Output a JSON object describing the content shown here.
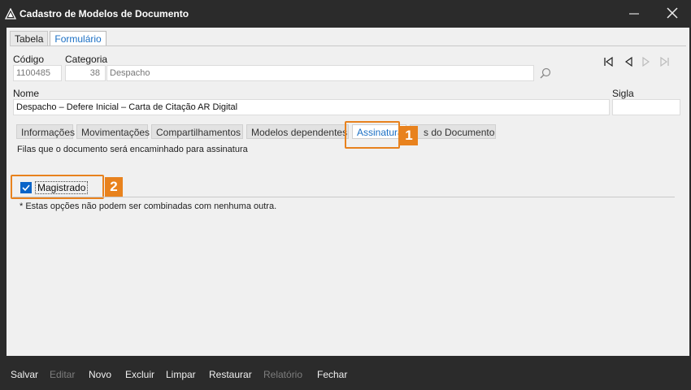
{
  "window": {
    "title": "Cadastro de Modelos de Documento"
  },
  "view_tabs": [
    {
      "label": "Tabela",
      "active": false
    },
    {
      "label": "Formulário",
      "active": true
    }
  ],
  "form": {
    "codigo_label": "Código",
    "codigo_value": "1100485",
    "categoria_label": "Categoria",
    "categoria_code": "38",
    "categoria_value": "Despacho",
    "nome_label": "Nome",
    "nome_value": "Despacho – Defere Inicial – Carta de Citação AR Digital",
    "sigla_label": "Sigla",
    "sigla_value": ""
  },
  "sub_tabs": [
    {
      "label": "Informações",
      "active": false
    },
    {
      "label": "Movimentações",
      "active": false
    },
    {
      "label": "Compartilhamentos",
      "active": false
    },
    {
      "label": "Modelos dependentes",
      "active": false
    },
    {
      "label": "Assinaturas",
      "active": true
    },
    {
      "label": "s do Documento",
      "active": false
    }
  ],
  "assinaturas": {
    "description": "Filas que o documento será encaminhado para assinatura",
    "checkbox_label": "Magistrado",
    "checkbox_checked": true,
    "note": "* Estas opções não podem ser combinadas com nenhuma outra."
  },
  "callouts": [
    "1",
    "2"
  ],
  "bottom_actions": [
    {
      "label": "Salvar",
      "enabled": true
    },
    {
      "label": "Editar",
      "enabled": false
    },
    {
      "label": "Novo",
      "enabled": true
    },
    {
      "label": "Excluir",
      "enabled": true
    },
    {
      "label": "Limpar",
      "enabled": true
    },
    {
      "label": "Restaurar",
      "enabled": true
    },
    {
      "label": "Relatório",
      "enabled": false
    },
    {
      "label": "Fechar",
      "enabled": true
    }
  ],
  "colors": {
    "accent": "#1a6fc4",
    "callout": "#e8821e",
    "titlebar": "#2b2b2b",
    "checkbox": "#0a64c8"
  },
  "icons": [
    "app-icon",
    "minimize-icon",
    "close-icon",
    "search-icon",
    "first-record-icon",
    "previous-record-icon",
    "next-record-icon",
    "last-record-icon",
    "checkmark-icon"
  ]
}
